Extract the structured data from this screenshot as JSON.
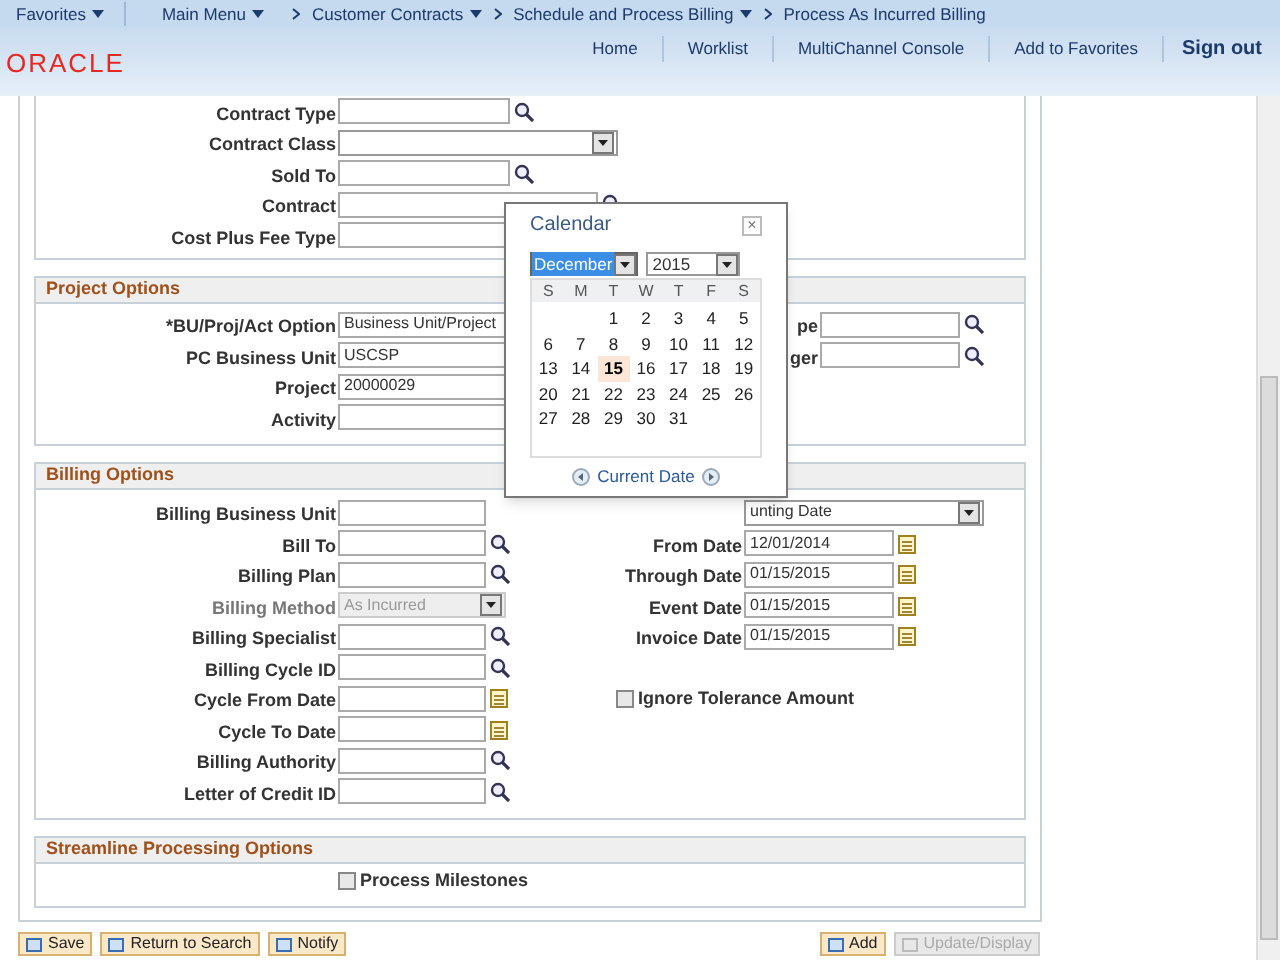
{
  "nav": {
    "items": [
      {
        "label": "Favorites",
        "menu": true
      },
      {
        "label": "Main Menu",
        "menu": true
      },
      {
        "label": "Customer Contracts",
        "menu": true
      },
      {
        "label": "Schedule and Process Billing",
        "menu": true
      },
      {
        "label": "Process As Incurred Billing",
        "menu": false
      }
    ]
  },
  "header": {
    "logo": "ORACLE",
    "links": [
      "Home",
      "Worklist",
      "MultiChannel Console",
      "Add to Favorites"
    ],
    "sign_out": "Sign out"
  },
  "contract_fields": [
    {
      "label": "Contract Type",
      "kind": "lookup"
    },
    {
      "label": "Contract Class",
      "kind": "select"
    },
    {
      "label": "Sold To",
      "kind": "lookup"
    },
    {
      "label": "Contract",
      "kind": "lookup"
    },
    {
      "label": "Cost Plus Fee Type",
      "kind": "text"
    }
  ],
  "sections": [
    {
      "kind": "project",
      "title": "Project Options",
      "left": [
        {
          "label": "*BU/Proj/Act Option",
          "kind": "text",
          "value": "Business Unit/Project",
          "disabled": false
        },
        {
          "label": "PC Business Unit",
          "kind": "text",
          "value": "USCSP",
          "disabled": false
        },
        {
          "label": "Project",
          "kind": "text",
          "value": "20000029",
          "disabled": false
        },
        {
          "label": "Activity",
          "kind": "text",
          "disabled": false
        }
      ],
      "right": [
        {
          "label": "pe",
          "kind": "lookup",
          "disabled": false
        },
        {
          "label": "ger",
          "kind": "lookup",
          "disabled": false
        }
      ]
    },
    {
      "kind": "billing",
      "title": "Billing Options",
      "left": [
        {
          "label": "Billing Business Unit",
          "kind": "text",
          "disabled": false
        },
        {
          "label": "Bill To",
          "kind": "lookup",
          "disabled": false
        },
        {
          "label": "Billing Plan",
          "kind": "lookup",
          "disabled": false
        },
        {
          "label": "Billing Method",
          "kind": "select",
          "value": "As Incurred",
          "disabled": true
        },
        {
          "label": "Billing Specialist",
          "kind": "lookup",
          "disabled": false
        },
        {
          "label": "Billing Cycle ID",
          "kind": "lookup",
          "disabled": false
        },
        {
          "label": "Cycle From Date",
          "kind": "date",
          "disabled": false
        },
        {
          "label": "Cycle To Date",
          "kind": "date",
          "disabled": false
        },
        {
          "label": "Billing Authority",
          "kind": "lookup",
          "disabled": false
        },
        {
          "label": "Letter of Credit ID",
          "kind": "lookup",
          "disabled": false
        }
      ],
      "right": [
        {
          "kind": "select",
          "value": "unting Date",
          "disabled": false
        },
        {
          "label": "From Date",
          "kind": "date",
          "value": "12/01/2014",
          "disabled": false
        },
        {
          "label": "Through Date",
          "kind": "date",
          "value": "01/15/2015",
          "disabled": false
        },
        {
          "label": "Event Date",
          "kind": "date",
          "value": "01/15/2015",
          "disabled": false
        },
        {
          "label": "Invoice Date",
          "kind": "date",
          "value": "01/15/2015",
          "disabled": false
        },
        {
          "kind": "spacer"
        },
        {
          "label": "Ignore Tolerance Amount",
          "kind": "checkbox",
          "checked": false
        }
      ]
    },
    {
      "kind": "streamline",
      "title": "Streamline Processing Options",
      "left": [
        {
          "label": "Process Milestones",
          "kind": "checkbox",
          "checked": false
        }
      ]
    }
  ],
  "buttons_left": [
    {
      "label": "Save",
      "disabled": false
    },
    {
      "label": "Return to Search",
      "disabled": false
    },
    {
      "label": "Notify",
      "disabled": false
    }
  ],
  "buttons_right": [
    {
      "label": "Add",
      "disabled": false
    },
    {
      "label": "Update/Display",
      "disabled": true
    }
  ],
  "calendar": {
    "title": "Calendar",
    "close": "×",
    "month": "December",
    "year": "2015",
    "weekdays": [
      "S",
      "M",
      "T",
      "W",
      "T",
      "F",
      "S"
    ],
    "cells": [
      null,
      null,
      {
        "day": "1",
        "selected": false
      },
      {
        "day": "2",
        "selected": false
      },
      {
        "day": "3",
        "selected": false
      },
      {
        "day": "4",
        "selected": false
      },
      {
        "day": "5",
        "selected": false
      },
      {
        "day": "6",
        "selected": false
      },
      {
        "day": "7",
        "selected": false
      },
      {
        "day": "8",
        "selected": false
      },
      {
        "day": "9",
        "selected": false
      },
      {
        "day": "10",
        "selected": false
      },
      {
        "day": "11",
        "selected": false
      },
      {
        "day": "12",
        "selected": false
      },
      {
        "day": "13",
        "selected": false
      },
      {
        "day": "14",
        "selected": false
      },
      {
        "day": "15",
        "selected": true
      },
      {
        "day": "16",
        "selected": false
      },
      {
        "day": "17",
        "selected": false
      },
      {
        "day": "18",
        "selected": false
      },
      {
        "day": "19",
        "selected": false
      },
      {
        "day": "20",
        "selected": false
      },
      {
        "day": "21",
        "selected": false
      },
      {
        "day": "22",
        "selected": false
      },
      {
        "day": "23",
        "selected": false
      },
      {
        "day": "24",
        "selected": false
      },
      {
        "day": "25",
        "selected": false
      },
      {
        "day": "26",
        "selected": false
      },
      {
        "day": "27",
        "selected": false
      },
      {
        "day": "28",
        "selected": false
      },
      {
        "day": "29",
        "selected": false
      },
      {
        "day": "30",
        "selected": false
      },
      {
        "day": "31",
        "selected": false
      }
    ],
    "current_date": "Current Date"
  }
}
